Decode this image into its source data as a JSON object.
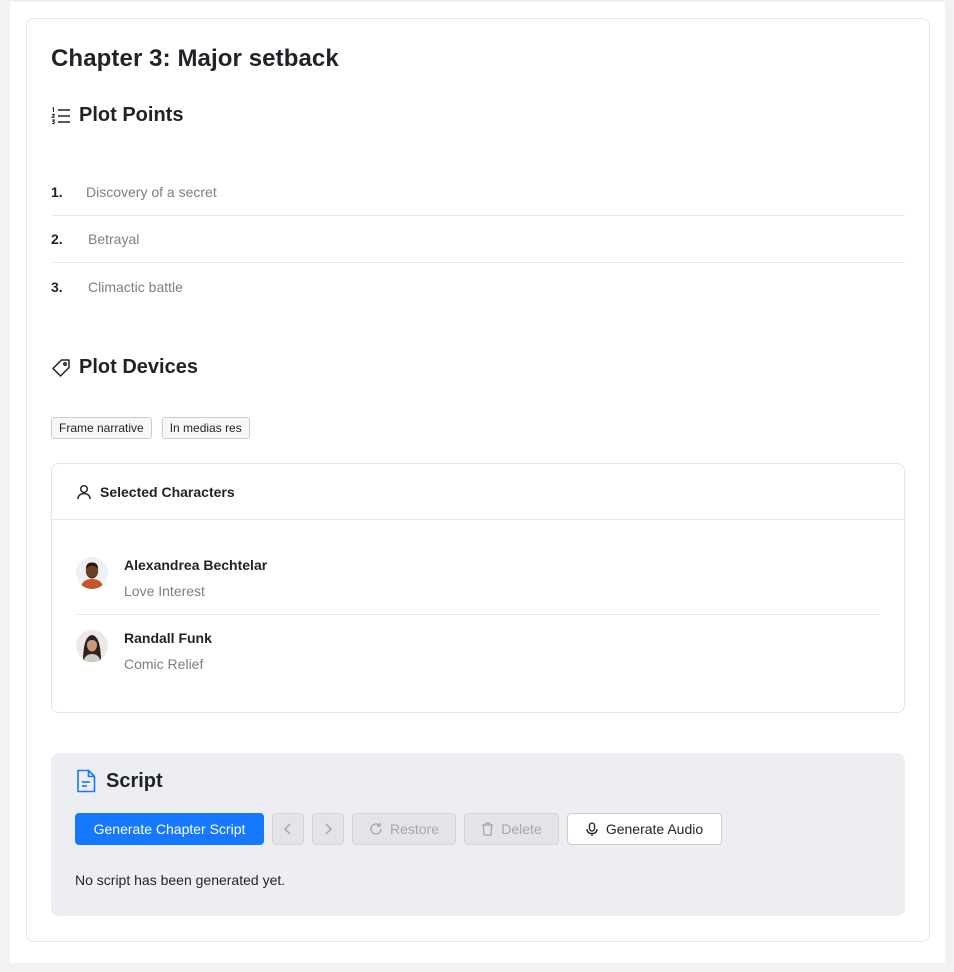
{
  "chapter": {
    "title": "Chapter 3: Major setback"
  },
  "plot_points": {
    "heading": "Plot Points",
    "items": [
      {
        "num": "1.",
        "text": "Discovery of a secret"
      },
      {
        "num": "2.",
        "text": "Betrayal"
      },
      {
        "num": "3.",
        "text": "Climactic battle"
      }
    ]
  },
  "plot_devices": {
    "heading": "Plot Devices",
    "tags": [
      "Frame narrative",
      "In medias res"
    ]
  },
  "characters": {
    "heading": "Selected Characters",
    "items": [
      {
        "name": "Alexandrea Bechtelar",
        "role": "Love Interest",
        "avatar": "avatar-man-icon"
      },
      {
        "name": "Randall Funk",
        "role": "Comic Relief",
        "avatar": "avatar-woman-icon"
      }
    ]
  },
  "script": {
    "heading": "Script",
    "buttons": {
      "generate": "Generate Chapter Script",
      "restore": "Restore",
      "delete": "Delete",
      "audio": "Generate Audio"
    },
    "empty_message": "No script has been generated yet."
  },
  "colors": {
    "accent": "#1677ff",
    "script_bg": "#eceef2",
    "muted_text": "#7a7f86"
  }
}
